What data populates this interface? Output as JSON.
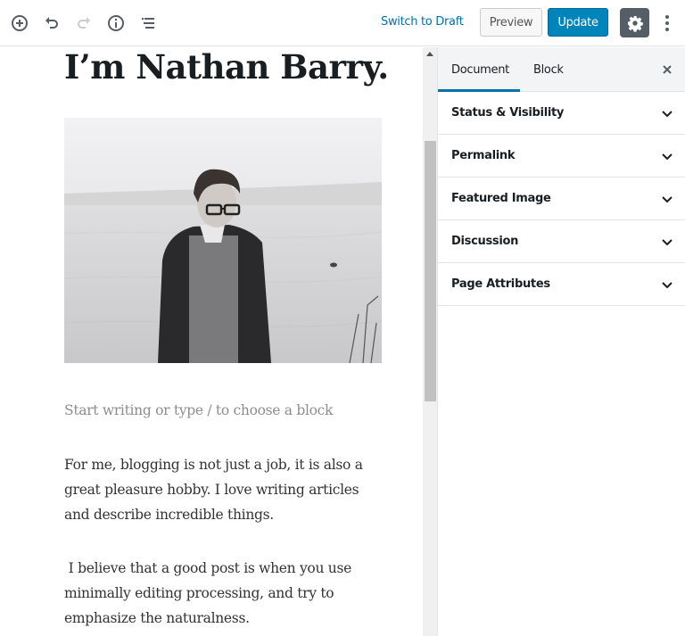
{
  "toolbar": {
    "icons": [
      "add-block-icon",
      "undo-icon",
      "redo-icon",
      "info-icon",
      "block-navigation-icon"
    ],
    "switch_to_draft": "Switch to Draft",
    "preview": "Preview",
    "update": "Update",
    "settings_icon": "gear-icon",
    "more_icon": "more-vertical-icon"
  },
  "editor": {
    "title": "I’m Nathan Barry.",
    "image_alt": "Black and white photo of a man with glasses standing by a lake",
    "placeholder": "Start writing or type / to choose a block",
    "paragraphs": [
      "For me, blogging is not just a job, it is also a\ngreat pleasure hobby. I love writing articles\nand describe incredible things.",
      " I believe that a good post is when you use\nminimally editing processing, and try to\nemphasize the naturalness."
    ]
  },
  "sidebar": {
    "tabs": [
      {
        "label": "Document",
        "active": true
      },
      {
        "label": "Block",
        "active": false
      }
    ],
    "close_icon": "close-icon",
    "panels": [
      {
        "label": "Status & Visibility"
      },
      {
        "label": "Permalink"
      },
      {
        "label": "Featured Image"
      },
      {
        "label": "Discussion"
      },
      {
        "label": "Page Attributes"
      }
    ]
  },
  "colors": {
    "accent": "#0073aa",
    "update_button": "#0085ba",
    "settings_button": "#555d66"
  }
}
